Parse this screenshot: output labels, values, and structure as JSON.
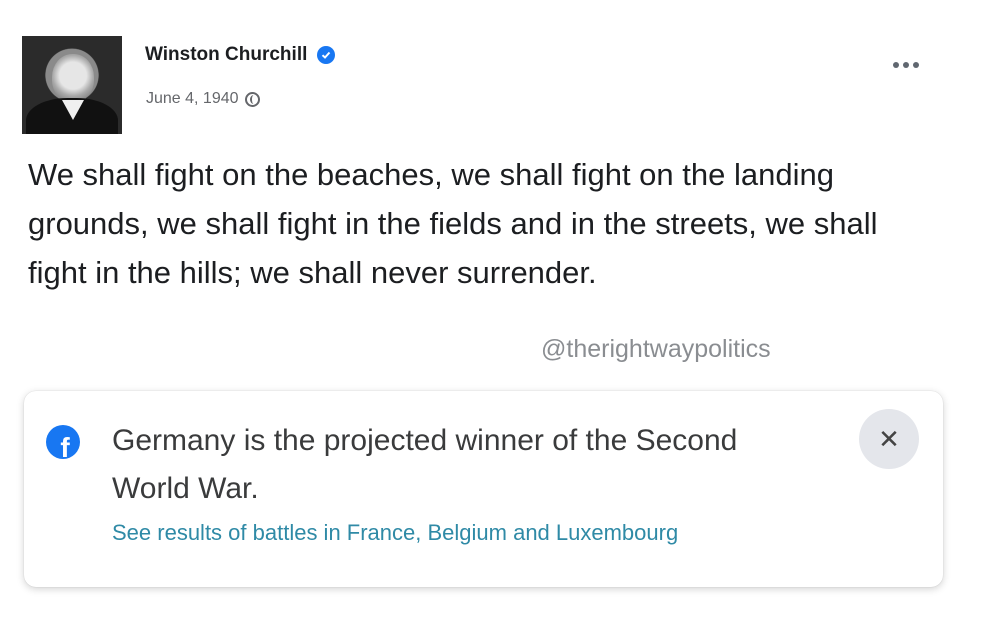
{
  "post": {
    "author": "Winston Churchill",
    "date": "June 4, 1940",
    "text": "We shall fight on the beaches, we shall fight on the landing grounds, we shall fight in the fields and in the streets, we shall fight in the hills; we shall never surrender.",
    "watermark": "@therightwaypolitics"
  },
  "icons": {
    "verified": "verified-badge-icon",
    "audience": "globe-icon",
    "more": "more-options-icon",
    "facebook": "facebook-logo-icon",
    "close": "close-icon"
  },
  "notice": {
    "message": "Germany is the projected winner of the Second World War.",
    "link": "See results of battles in France, Belgium and Luxembourg",
    "close_glyph": "✕"
  },
  "colors": {
    "brand": "#1877f2",
    "link": "#2f8aa6",
    "secondary_text": "#65676b"
  }
}
